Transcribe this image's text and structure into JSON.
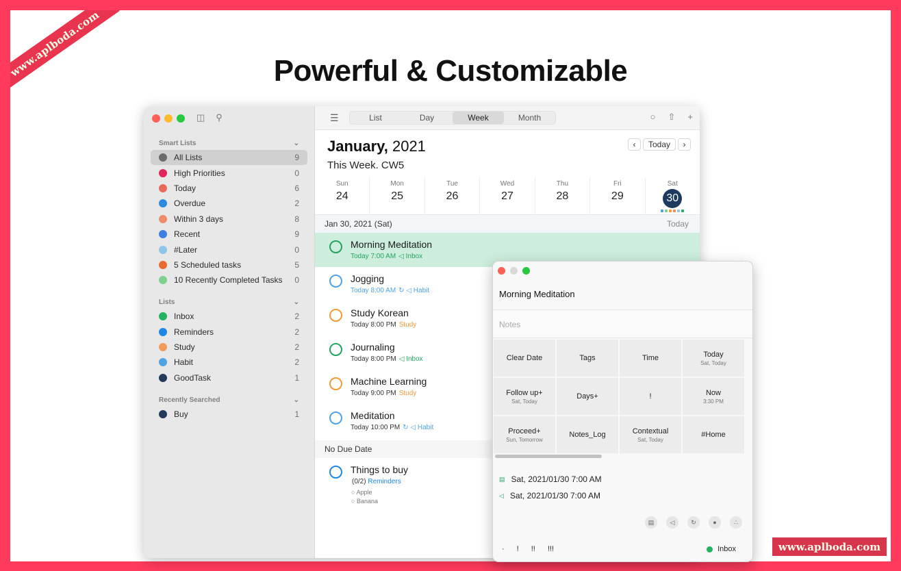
{
  "watermark_text": "www.aplboda.com",
  "headline": "Powerful & Customizable",
  "toolbar": {
    "tabs": [
      {
        "label": "List"
      },
      {
        "label": "Day"
      },
      {
        "label": "Week"
      },
      {
        "label": "Month"
      }
    ],
    "active_tab": "Week"
  },
  "sidebar": {
    "smart_lists_title": "Smart Lists",
    "smart_lists": [
      {
        "label": "All Lists",
        "count": "9",
        "color": "#6b6b6b"
      },
      {
        "label": "High Priorities",
        "count": "0",
        "color": "#e2245a"
      },
      {
        "label": "Today",
        "count": "6",
        "color": "#e96a5a"
      },
      {
        "label": "Overdue",
        "count": "2",
        "color": "#2c8be0"
      },
      {
        "label": "Within 3 days",
        "count": "8",
        "color": "#f08b6a"
      },
      {
        "label": "Recent",
        "count": "9",
        "color": "#3e7fe0"
      },
      {
        "label": "#Later",
        "count": "0",
        "color": "#8ec6ea"
      },
      {
        "label": "5 Scheduled tasks",
        "count": "5",
        "color": "#e86a2c"
      },
      {
        "label": "10 Recently Completed Tasks",
        "count": "0",
        "color": "#7fd08f"
      }
    ],
    "lists_title": "Lists",
    "lists": [
      {
        "label": "Inbox",
        "count": "2",
        "color": "#23b25f"
      },
      {
        "label": "Reminders",
        "count": "2",
        "color": "#1f87e8"
      },
      {
        "label": "Study",
        "count": "2",
        "color": "#f29a5a"
      },
      {
        "label": "Habit",
        "count": "2",
        "color": "#4fa3e4"
      },
      {
        "label": "GoodTask",
        "count": "1",
        "color": "#233a5a"
      }
    ],
    "recent_title": "Recently Searched",
    "recent": [
      {
        "label": "Buy",
        "count": "1",
        "color": "#233a5a"
      }
    ]
  },
  "calendar": {
    "month_bold": "January,",
    "year": " 2021",
    "week_label": "This Week. CW5",
    "today_button": "Today",
    "days": [
      {
        "name": "Sun",
        "date": "24"
      },
      {
        "name": "Mon",
        "date": "25"
      },
      {
        "name": "Tue",
        "date": "26"
      },
      {
        "name": "Wed",
        "date": "27"
      },
      {
        "name": "Thu",
        "date": "28"
      },
      {
        "name": "Fri",
        "date": "29"
      },
      {
        "name": "Sat",
        "date": "30"
      }
    ],
    "selected_date_header": "Jan 30, 2021 (Sat)",
    "selected_date_tag": "Today",
    "no_due_label": "No Due Date"
  },
  "tasks": [
    {
      "title": "Morning Meditation",
      "time": "Today 7:00 AM",
      "tag": "◁ Inbox",
      "tag_color": "#23a35f",
      "time_color": "#23a35f",
      "circle": "#23a35f"
    },
    {
      "title": "Jogging",
      "time": "Today 8:00 AM",
      "tag": "↻ ◁ Habit",
      "tag_color": "#4fa3e4",
      "time_color": "#4fa3e4",
      "circle": "#4fa3e4"
    },
    {
      "title": "Study Korean",
      "time": "Today 8:00 PM",
      "tag": "Study",
      "tag_color": "#f29a3a",
      "time_color": "#333333",
      "circle": "#f29a3a"
    },
    {
      "title": "Journaling",
      "time": "Today 8:00 PM",
      "tag": "◁ Inbox",
      "tag_color": "#23a35f",
      "time_color": "#333333",
      "circle": "#23a35f"
    },
    {
      "title": "Machine Learning",
      "time": "Today 9:00 PM",
      "tag": "Study",
      "tag_color": "#f29a3a",
      "time_color": "#333333",
      "circle": "#f29a3a"
    },
    {
      "title": "Meditation",
      "time": "Today 10:00 PM",
      "tag": "↻ ◁ Habit",
      "tag_color": "#4fa3e4",
      "time_color": "#333333",
      "circle": "#4fa3e4"
    }
  ],
  "nodue_task": {
    "title": "Things to buy",
    "progress": "(0/2)",
    "list": "Reminders",
    "subitems": [
      "Apple",
      "Banana"
    ],
    "circle": "#1f87e8"
  },
  "popup": {
    "title": "Morning Meditation",
    "notes_placeholder": "Notes",
    "actions": [
      {
        "label": "Clear Date",
        "sub": ""
      },
      {
        "label": "Tags",
        "sub": ""
      },
      {
        "label": "Time",
        "sub": ""
      },
      {
        "label": "Today",
        "sub": "Sat, Today"
      },
      {
        "label": "Follow up+",
        "sub": "Sat, Today"
      },
      {
        "label": "Days+",
        "sub": ""
      },
      {
        "label": "!",
        "sub": ""
      },
      {
        "label": "Now",
        "sub": "3:30 PM"
      },
      {
        "label": "Proceed+",
        "sub": "Sun, Tomorrow"
      },
      {
        "label": "Notes_Log",
        "sub": ""
      },
      {
        "label": "Contextual",
        "sub": "Sat, Today"
      },
      {
        "label": "#Home",
        "sub": ""
      }
    ],
    "due_date": "Sat, 2021/01/30 7:00 AM",
    "alert_date": "Sat, 2021/01/30 7:00 AM",
    "priorities": [
      "·",
      "!",
      "!!",
      "!!!"
    ],
    "list_name": "Inbox"
  }
}
